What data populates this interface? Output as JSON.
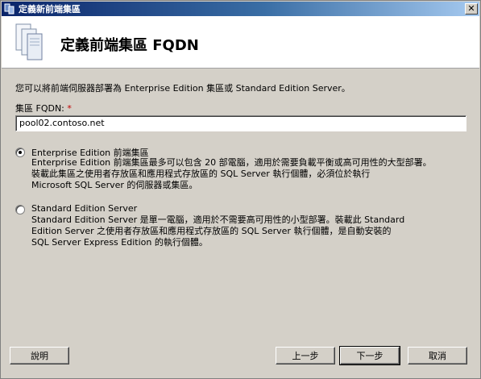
{
  "window": {
    "title": "定義新前端集區",
    "close_glyph": "✕"
  },
  "header": {
    "title": "定義前端集區 FQDN"
  },
  "intro_text": "您可以將前端伺服器部署為 Enterprise Edition 集區或 Standard Edition Server。",
  "fqdn": {
    "label": "集區 FQDN:",
    "required_marker": "*",
    "value": "pool02.contoso.net"
  },
  "options": [
    {
      "title": "Enterprise Edition 前端集區",
      "checked": true,
      "desc_lines": [
        "Enterprise Edition 前端集區最多可以包含 20 部電腦，適用於需要負載平衡或高可用性的大型部署。",
        "裝載此集區之使用者存放區和應用程式存放區的 SQL Server 執行個體，必須位於執行",
        "Microsoft SQL Server 的伺服器或集區。"
      ]
    },
    {
      "title": "Standard Edition Server",
      "checked": false,
      "desc_lines": [
        "Standard Edition Server 是單一電腦，適用於不需要高可用性的小型部署。裝載此 Standard",
        "Edition Server 之使用者存放區和應用程式存放區的 SQL Server 執行個體，是自動安裝的",
        "SQL Server Express Edition 的執行個體。"
      ]
    }
  ],
  "buttons": {
    "help": "說明",
    "back": "上一步",
    "next": "下一步",
    "cancel": "取消"
  }
}
